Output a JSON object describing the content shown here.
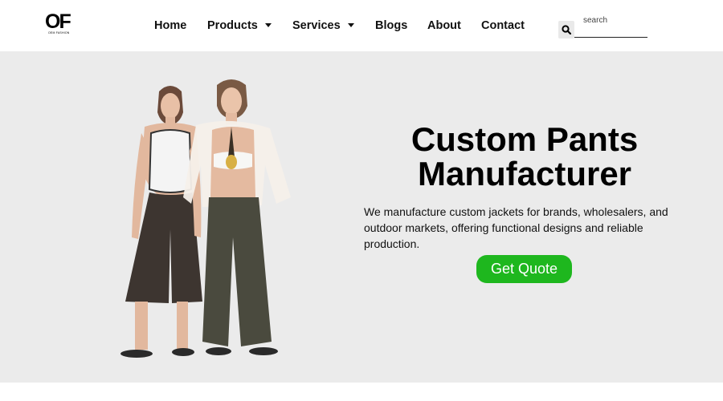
{
  "brand": {
    "mark": "OF",
    "tagline": "OEM FASHION"
  },
  "nav": {
    "home": "Home",
    "products": "Products",
    "services": "Services",
    "blogs": "Blogs",
    "about": "About",
    "contact": "Contact"
  },
  "search": {
    "placeholder": "search",
    "icon": "search-icon"
  },
  "hero": {
    "title_line1": "Custom Pants",
    "title_line2": "Manufacturer",
    "description": "We manufacture custom jackets for brands, wholesalers, and outdoor markets, offering functional designs and reliable production.",
    "cta_label": "Get Quote"
  },
  "colors": {
    "hero_background": "#ebebeb",
    "cta_green": "#1eb71e",
    "text": "#000000"
  }
}
